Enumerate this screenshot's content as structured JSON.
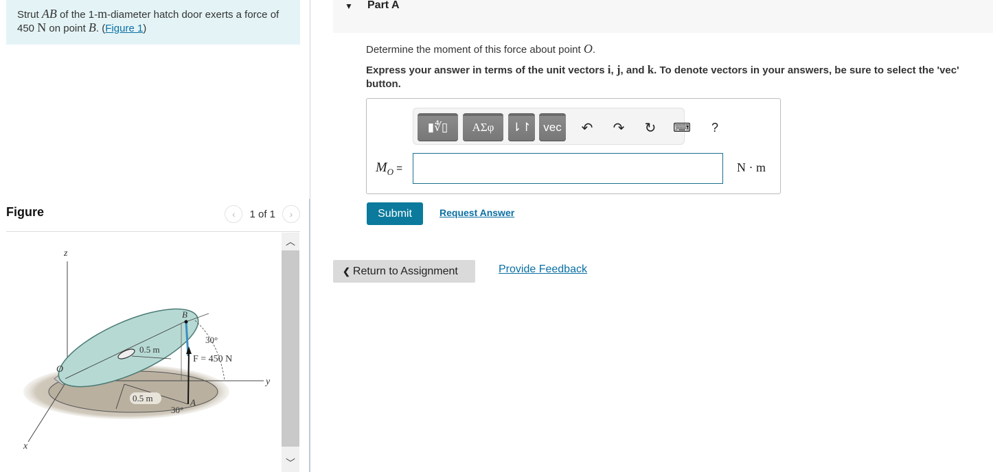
{
  "problem": {
    "text_1": "Strut ",
    "strut_label": "AB",
    "text_2": " of the 1-",
    "unit_m": "m",
    "text_3": "-diameter hatch door exerts a force of 450 ",
    "unit_N": "N",
    "text_4": " on point ",
    "point_label": "B",
    "text_5": ". (",
    "figure_link": "Figure 1",
    "text_6": ")"
  },
  "figure_panel": {
    "title": "Figure",
    "pager_text": "1 of 1",
    "prev_icon": "‹",
    "next_icon": "›",
    "labels": {
      "z_axis": "z",
      "x_axis": "x",
      "y_axis": "y",
      "origin": "O",
      "point_b": "B",
      "point_a": "A",
      "radius_top": "0.5 m",
      "radius_bottom": "0.5 m",
      "angle_top": "30°",
      "angle_bottom": "30°",
      "force": "F = 450 N"
    }
  },
  "part": {
    "caret": "▼",
    "title": "Part A",
    "question_text": "Determine the moment of this force about point ",
    "question_point": "O",
    "question_end": ".",
    "instruction_1": "Express your answer in terms of the unit vectors ",
    "vec_i": "i",
    "sep_1": ", ",
    "vec_j": "j",
    "sep_2": ", and ",
    "vec_k": "k",
    "instruction_2": ". To denote vectors in your answers, be sure to select the 'vec' button."
  },
  "toolbar": {
    "templates_label": "▮∜▯",
    "greek_label": "ΑΣφ",
    "arrows_label": "⇂↾",
    "vec_label": "vec",
    "undo_icon": "↶",
    "redo_icon": "↷",
    "reset_icon": "↻",
    "keyboard_icon": "⌨",
    "help_label": "?"
  },
  "answer": {
    "variable": "M",
    "subscript": "O",
    "equals": " =",
    "value": "",
    "unit": "N · m"
  },
  "actions": {
    "submit_label": "Submit",
    "request_answer_label": "Request Answer",
    "return_label": "Return to Assignment",
    "return_icon": "❮",
    "feedback_label": "Provide Feedback"
  },
  "colors": {
    "accent": "#0b7a9c",
    "link": "#0a6fa3",
    "problem_bg": "#e4f4f6",
    "hatch_door": "#b7d9d4",
    "ground_shadow": "#b9b0a0"
  }
}
